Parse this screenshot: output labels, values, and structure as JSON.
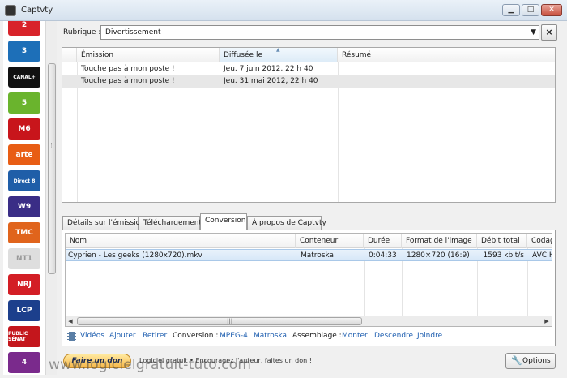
{
  "window": {
    "title": "Captvty"
  },
  "channels": [
    {
      "name": "france2-logo",
      "label": "2",
      "color": "#d8232a"
    },
    {
      "name": "france3-logo",
      "label": "3",
      "color": "#1d6fb8"
    },
    {
      "name": "canalplus-logo",
      "label": "CANAL+",
      "color": "#111111"
    },
    {
      "name": "france5-logo",
      "label": "5",
      "color": "#6ab42d"
    },
    {
      "name": "m6-logo",
      "label": "M6",
      "color": "#c8151b"
    },
    {
      "name": "arte-logo",
      "label": "arte",
      "color": "#e85d14"
    },
    {
      "name": "direct8-logo",
      "label": "Direct 8",
      "color": "#1f5ea8"
    },
    {
      "name": "w9-logo",
      "label": "W9",
      "color": "#3a2d86"
    },
    {
      "name": "tmc-logo",
      "label": "TMC",
      "color": "#e0641c"
    },
    {
      "name": "nt1-logo",
      "label": "NT1",
      "color": "#dedede"
    },
    {
      "name": "nrj12-logo",
      "label": "NRJ",
      "color": "#d31e25"
    },
    {
      "name": "lcp-logo",
      "label": "LCP",
      "color": "#1c3f8c"
    },
    {
      "name": "publicsenat-logo",
      "label": "PUBLIC SÉNAT",
      "color": "#c4161c"
    },
    {
      "name": "france4-logo",
      "label": "4",
      "color": "#7a2a8c"
    }
  ],
  "rubrique": {
    "label": "Rubrique :",
    "value": "Divertissement",
    "close_label": "×"
  },
  "emissions": {
    "columns": [
      "Émission",
      "Diffusée le",
      "Résumé"
    ],
    "rows": [
      {
        "emission": "Touche pas à mon poste !",
        "diffusee": "Jeu. 7 juin 2012, 22 h 40",
        "resume": ""
      },
      {
        "emission": "Touche pas à mon poste !",
        "diffusee": "Jeu. 31 mai 2012, 22 h 40",
        "resume": ""
      }
    ]
  },
  "tabs": [
    {
      "label": "Détails sur l'émission",
      "active": false
    },
    {
      "label": "Téléchargement",
      "active": false
    },
    {
      "label": "Conversion",
      "active": true
    },
    {
      "label": "À propos de Captvty",
      "active": false
    }
  ],
  "conversion": {
    "columns": [
      "Nom",
      "Conteneur",
      "Durée",
      "Format de l'image",
      "Débit total",
      "Codage"
    ],
    "rows": [
      {
        "nom": "Cyprien - Les geeks (1280x720).mkv",
        "conteneur": "Matroska",
        "duree": "0:04:33",
        "format": "1280×720 (16:9)",
        "debit": "1593 kbit/s",
        "codage": "AVC Hi"
      }
    ]
  },
  "toolbar": {
    "videos": "Vidéos",
    "ajouter": "Ajouter",
    "retirer": "Retirer",
    "conversion_label": "Conversion :",
    "mpeg4": "MPEG-4",
    "matroska": "Matroska",
    "assemblage_label": "Assemblage :",
    "monter": "Monter",
    "descendre": "Descendre",
    "joindre": "Joindre"
  },
  "footer": {
    "donate": "Faire un don",
    "donate_text": "Logiciel gratuit • Encouragez l'auteur, faites un don !",
    "options": "Options",
    "watermark": "www.logicielgratuit-tuto.com"
  }
}
